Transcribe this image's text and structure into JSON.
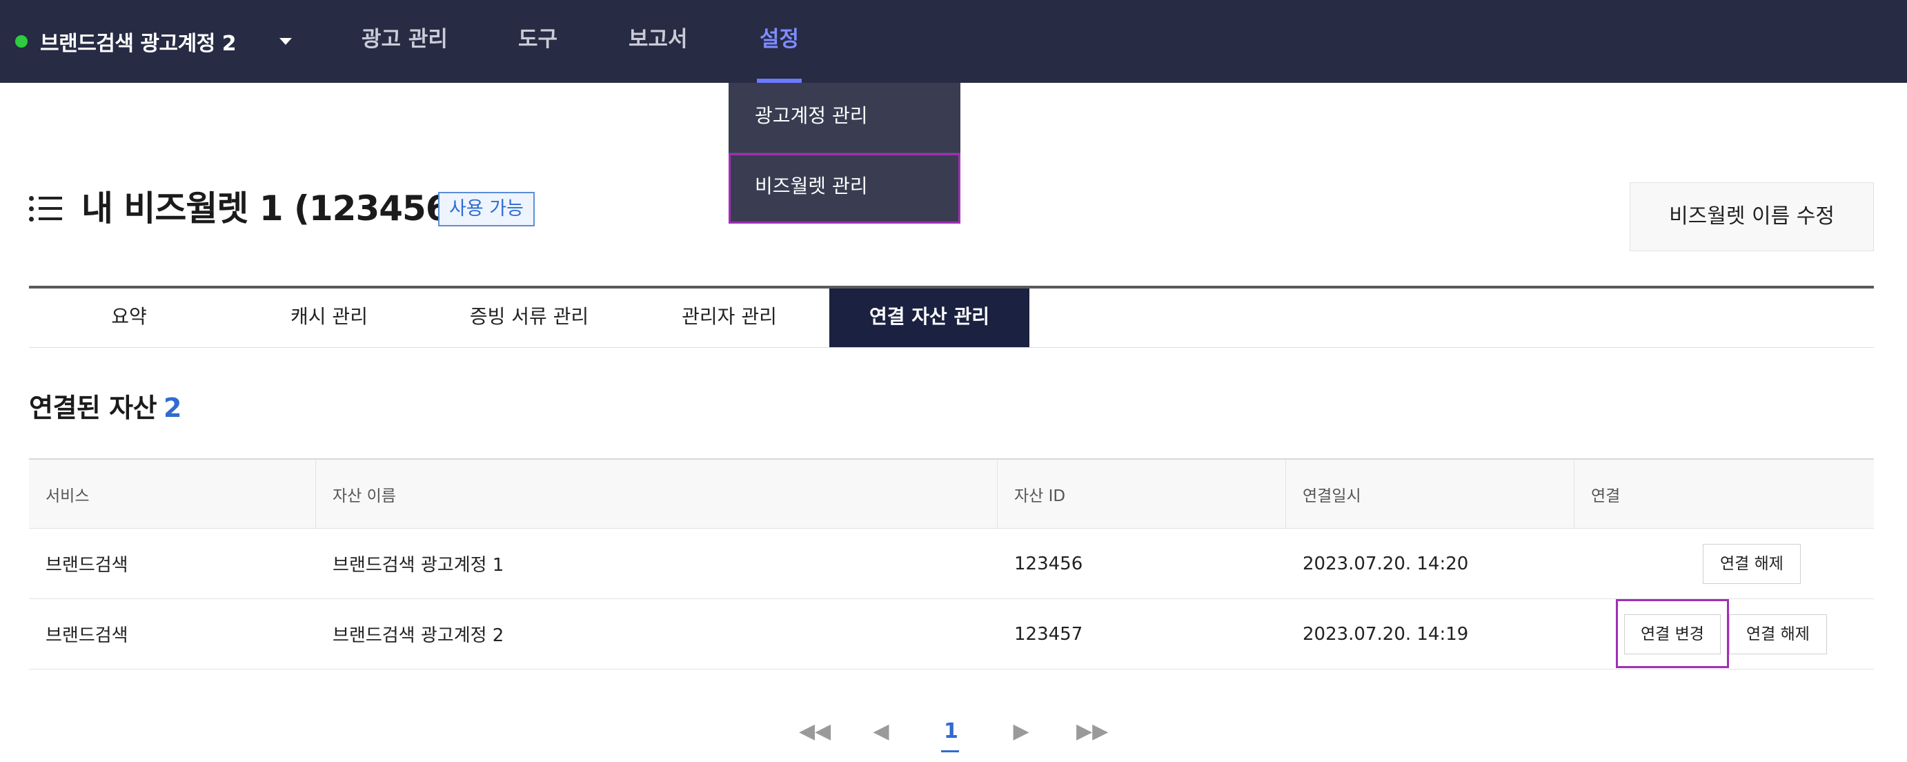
{
  "topnav": {
    "account_name": "브랜드검색 광고계정 2",
    "account_status_color": "#2ecc40",
    "items": [
      {
        "label": "광고 관리"
      },
      {
        "label": "도구"
      },
      {
        "label": "보고서"
      },
      {
        "label": "설정",
        "active": true
      }
    ]
  },
  "dropdown": {
    "items": [
      {
        "label": "광고계정 관리"
      },
      {
        "label": "비즈월렛 관리",
        "highlighted": true
      }
    ]
  },
  "header": {
    "title": "내 비즈월렛 1 (123456)",
    "status_badge": "사용 가능",
    "rename_button": "비즈월렛 이름 수정"
  },
  "tabs": [
    {
      "label": "요약"
    },
    {
      "label": "캐시 관리"
    },
    {
      "label": "증빙 서류 관리"
    },
    {
      "label": "관리자 관리"
    },
    {
      "label": "연결 자산 관리",
      "active": true
    }
  ],
  "section": {
    "title": "연결된 자산",
    "count": "2"
  },
  "table": {
    "columns": [
      "서비스",
      "자산 이름",
      "자산 ID",
      "연결일시",
      "연결"
    ],
    "rows": [
      {
        "service": "브랜드검색",
        "asset_name": "브랜드검색 광고계정 1",
        "asset_id": "123456",
        "connected_at": "2023.07.20. 14:20",
        "actions": [
          "연결 해제"
        ]
      },
      {
        "service": "브랜드검색",
        "asset_name": "브랜드검색 광고계정 2",
        "asset_id": "123457",
        "connected_at": "2023.07.20. 14:19",
        "actions": [
          "연결 변경",
          "연결 해제"
        ]
      }
    ]
  },
  "pagination": {
    "first": "◀◀",
    "prev": "◀",
    "current_page": "1",
    "next": "▶",
    "last": "▶▶"
  },
  "colors": {
    "nav_bg": "#272b44",
    "nav_active": "#7f8cff",
    "accent_blue": "#2f6bd2",
    "tab_active_bg": "#1b2140",
    "highlight_border": "#a12fb5"
  }
}
